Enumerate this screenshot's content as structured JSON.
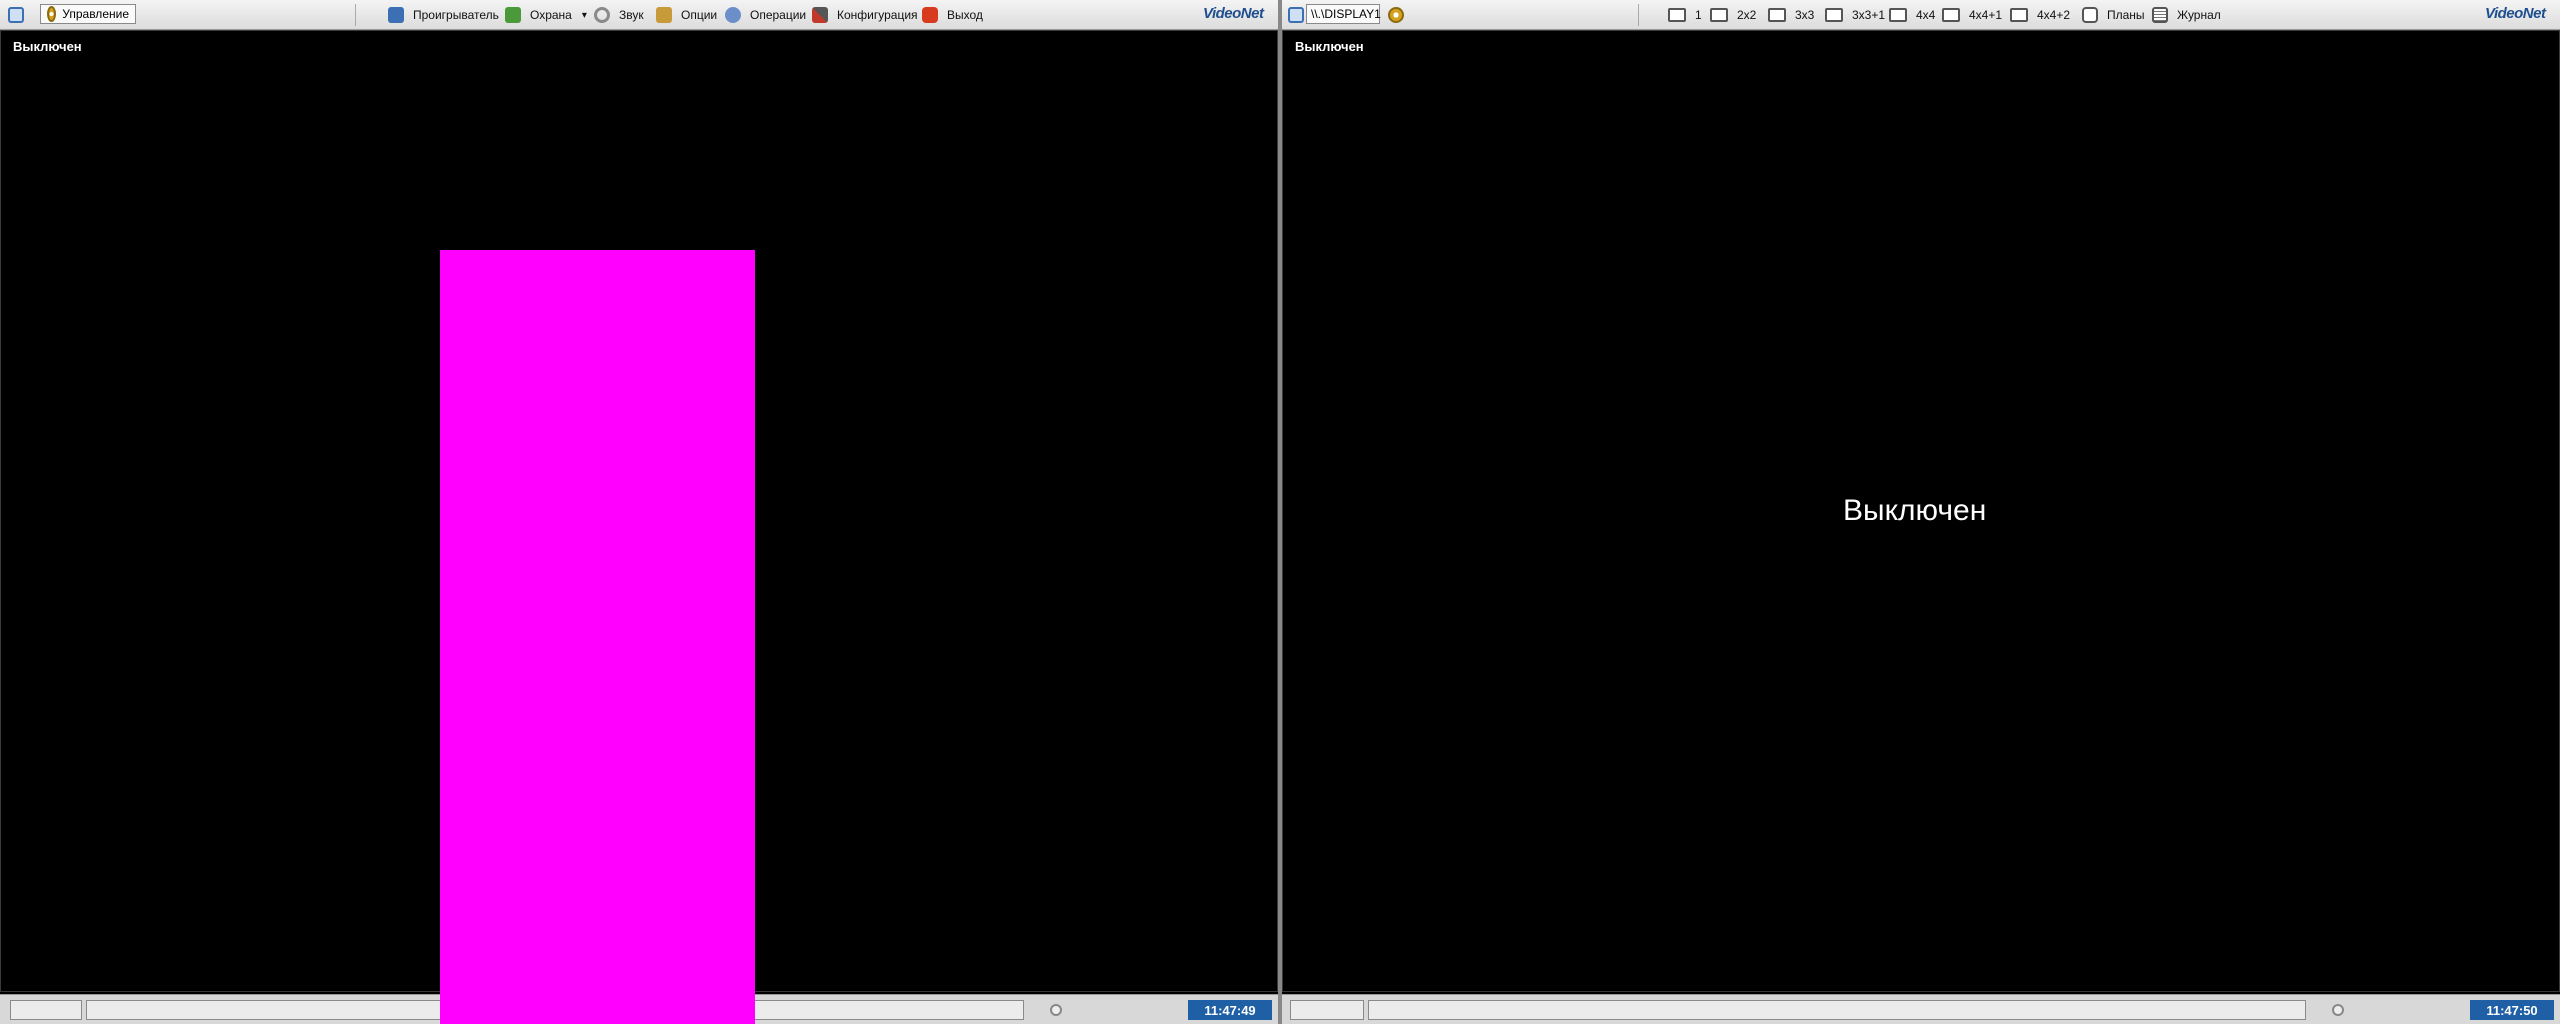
{
  "left_toolbar": {
    "control_label": "Управление",
    "menu": [
      {
        "label": "Проигрыватель",
        "icon": "player-icon"
      },
      {
        "label": "Охрана",
        "icon": "guard-icon"
      },
      {
        "label": "Звук",
        "icon": "sound-icon"
      },
      {
        "label": "Опции",
        "icon": "options-icon"
      },
      {
        "label": "Операции",
        "icon": "operations-icon"
      },
      {
        "label": "Конфигурация",
        "icon": "config-icon"
      },
      {
        "label": "Выход",
        "icon": "exit-icon"
      }
    ],
    "dropdown_glyph": "▾",
    "logo": "VideoNet"
  },
  "right_toolbar": {
    "display_label": "\\\\.\\DISPLAY1",
    "layouts": [
      "1",
      "2x2",
      "3x3",
      "3x3+1",
      "4x4",
      "4x4+1",
      "4x4+2"
    ],
    "plans_label": "Планы",
    "journal_label": "Журнал",
    "logo": "VideoNet"
  },
  "left_pane": {
    "label": "Выключен"
  },
  "right_pane": {
    "label": "Выключен",
    "center_text": "Выключен"
  },
  "left_status": {
    "time": "11:47:49"
  },
  "right_status": {
    "time": "11:47:50"
  },
  "colors": {
    "overlay": "#ff00ff",
    "clock_bg": "#1f5fa6",
    "logo": "#1f4f8f"
  }
}
